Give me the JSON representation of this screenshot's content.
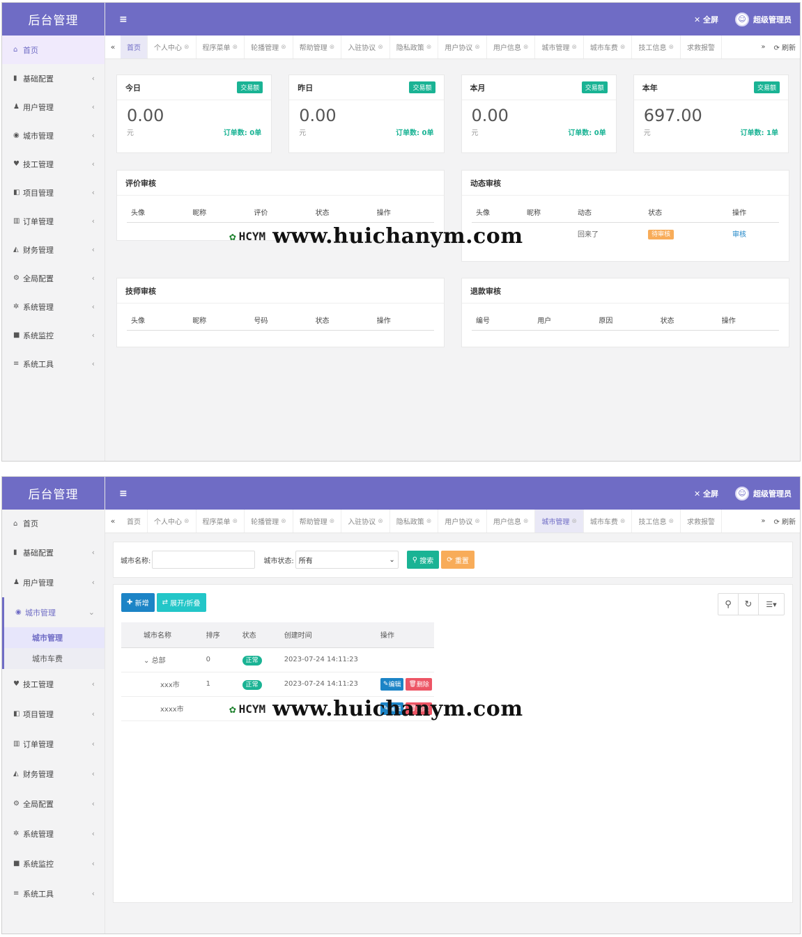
{
  "app": {
    "title": "后台管理",
    "fullscreen": "全屏",
    "user": "超级管理员"
  },
  "menu": {
    "home": "首页",
    "items": [
      "基础配置",
      "用户管理",
      "城市管理",
      "技工管理",
      "项目管理",
      "订单管理",
      "财务管理",
      "全局配置",
      "系统管理",
      "系统监控",
      "系统工具"
    ],
    "city_sub": [
      "城市管理",
      "城市车费"
    ]
  },
  "tabs": [
    "首页",
    "个人中心",
    "程序菜单",
    "轮播管理",
    "帮助管理",
    "入驻协议",
    "隐私政策",
    "用户协议",
    "用户信息",
    "城市管理",
    "城市车费",
    "技工信息",
    "求救报警"
  ],
  "refresh": "刷新",
  "stats": [
    {
      "title": "今日",
      "badge": "交易额",
      "value": "0.00",
      "unit": "元",
      "orders": "订单数: 0单"
    },
    {
      "title": "昨日",
      "badge": "交易额",
      "value": "0.00",
      "unit": "元",
      "orders": "订单数: 0单"
    },
    {
      "title": "本月",
      "badge": "交易额",
      "value": "0.00",
      "unit": "元",
      "orders": "订单数: 0单"
    },
    {
      "title": "本年",
      "badge": "交易额",
      "value": "697.00",
      "unit": "元",
      "orders": "订单数: 1单"
    }
  ],
  "panels": {
    "review": {
      "title": "评价审核",
      "cols": [
        "头像",
        "昵称",
        "评价",
        "状态",
        "操作"
      ]
    },
    "dynamic": {
      "title": "动态审核",
      "cols": [
        "头像",
        "昵称",
        "动态",
        "状态",
        "操作"
      ],
      "row": {
        "content": "回来了",
        "status": "待审核",
        "action": "审核"
      }
    },
    "tech": {
      "title": "技师审核",
      "cols": [
        "头像",
        "昵称",
        "号码",
        "状态",
        "操作"
      ]
    },
    "refund": {
      "title": "退款审核",
      "cols": [
        "编号",
        "用户",
        "原因",
        "状态",
        "操作"
      ]
    }
  },
  "watermark": {
    "logo": "HCYM",
    "url": "www.huichanym.com"
  },
  "city": {
    "search_label": "城市名称:",
    "status_label": "城市状态:",
    "status_value": "所有",
    "search_btn": "搜索",
    "reset_btn": "重置",
    "add_btn": "新增",
    "expand_btn": "展开/折叠",
    "cols": [
      "城市名称",
      "排序",
      "状态",
      "创建时间",
      "操作"
    ],
    "rows": [
      {
        "name": "总部",
        "sort": "0",
        "status": "正常",
        "time": "2023-07-24 14:11:23"
      },
      {
        "name": "xxx市",
        "sort": "1",
        "status": "正常",
        "time": "2023-07-24 14:11:23"
      },
      {
        "name": "xxxx市",
        "sort": "",
        "status": "",
        "time": ""
      }
    ],
    "edit_btn": "编辑",
    "del_btn": "删除"
  },
  "colors": {
    "primary": "#6f6cc5",
    "green": "#1ab394",
    "orange": "#f8ac59",
    "blue": "#1c84c6",
    "red": "#ed5565"
  }
}
